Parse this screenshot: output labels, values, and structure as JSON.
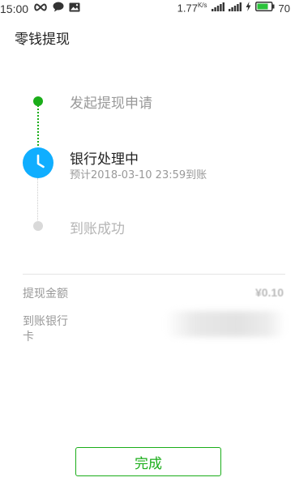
{
  "status_bar": {
    "time": "15:00",
    "network_speed": "1.77",
    "network_speed_unit": "K/s",
    "battery_level": "70",
    "icons": [
      "infinity-icon",
      "chat-bubble-icon",
      "image-message-icon",
      "signal-bars-icon",
      "signal-bars-icon",
      "charging-icon",
      "battery-icon"
    ]
  },
  "header": {
    "title": "零钱提现"
  },
  "progress": {
    "steps": [
      {
        "label": "发起提现申请",
        "state": "done"
      },
      {
        "label": "银行处理中",
        "sub": "预计2018-03-10 23:59到账",
        "state": "current"
      },
      {
        "label": "到账成功",
        "state": "pending"
      }
    ]
  },
  "details": {
    "amount_label": "提现金额",
    "amount_value": "¥0.10",
    "bank_label": "到账银行卡"
  },
  "actions": {
    "done_label": "完成"
  },
  "colors": {
    "accent_green": "#1aad19",
    "processing_blue": "#10aeff",
    "muted_gray": "#999999",
    "pending_gray": "#d9d9d9"
  }
}
